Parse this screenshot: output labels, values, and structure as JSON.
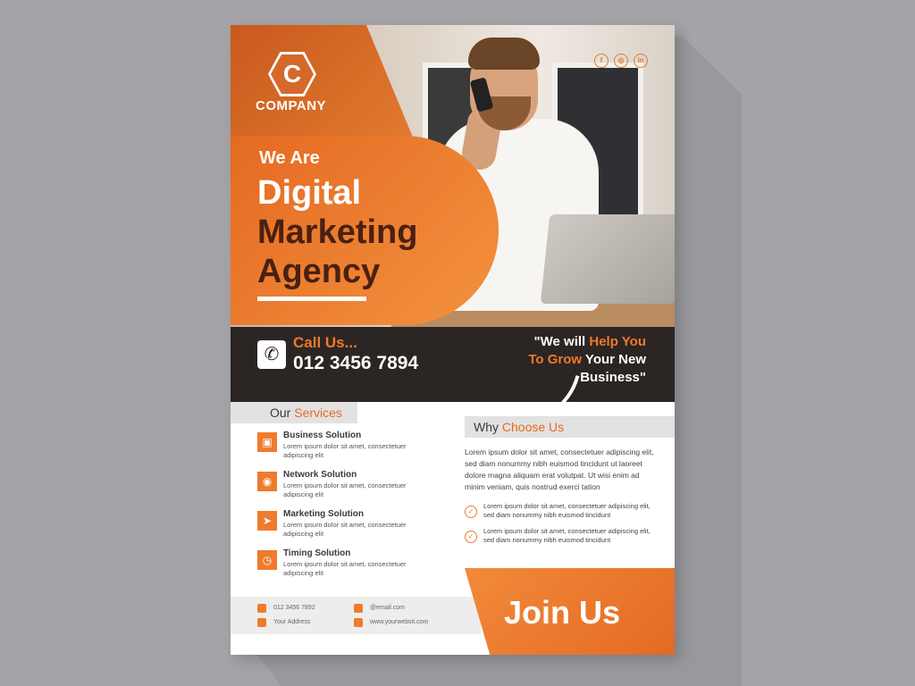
{
  "flyer": {
    "company": "COMPANY",
    "logo_letter": "C",
    "headline": {
      "line0": "We Are",
      "line1": "Digital",
      "line2": "Marketing",
      "line3": "Agency"
    },
    "call": {
      "label": "Call Us...",
      "number": "012 3456 7894"
    },
    "slogan": {
      "part1": "\"We will ",
      "acc1": "Help You",
      "acc2": "To Grow",
      "part2": " Your New",
      "part3": "Business\""
    },
    "services": {
      "title_plain": "Our ",
      "title_accent": "Services",
      "items": [
        {
          "title": "Business Solution",
          "desc": "Lorem ipsum dolor sit amet, consectetuer adipiscing elit"
        },
        {
          "title": "Network Solution",
          "desc": "Lorem ipsum dolor sit amet, consectetuer adipiscing elit"
        },
        {
          "title": "Marketing Solution",
          "desc": "Lorem ipsum dolor sit amet, consectetuer adipiscing elit"
        },
        {
          "title": "Timing Solution",
          "desc": "Lorem ipsum dolor sit amet, consectetuer adipiscing elit"
        }
      ]
    },
    "why": {
      "title_plain": "Why ",
      "title_accent": "Choose Us",
      "body": "Lorem ipsum dolor sit amet, consectetuer adipiscing elit, sed diam nonummy nibh euismod tincidunt ut laoreet dolore magna aliquam erat volutpat. Ut wisi enim ad minim veniam, quis nostrud exerci tation",
      "points": [
        "Lorem ipsum dolor sit amet, consectetuer adipiscing elit, sed diam nonummy nibh euismod tincidunt",
        "Lorem ipsum dolor sit amet, consectetuer adipiscing elit, sed diam nonummy nibh euismod tincidunt"
      ]
    },
    "join": "Join Us",
    "contact": {
      "phone": "012 3456 7892",
      "email": "@email.com",
      "address": "Your Address",
      "website": "www.yourwebsit.com"
    },
    "colors": {
      "accent": "#e8691c",
      "dark": "#2b2523",
      "deep": "#4a2010"
    }
  }
}
